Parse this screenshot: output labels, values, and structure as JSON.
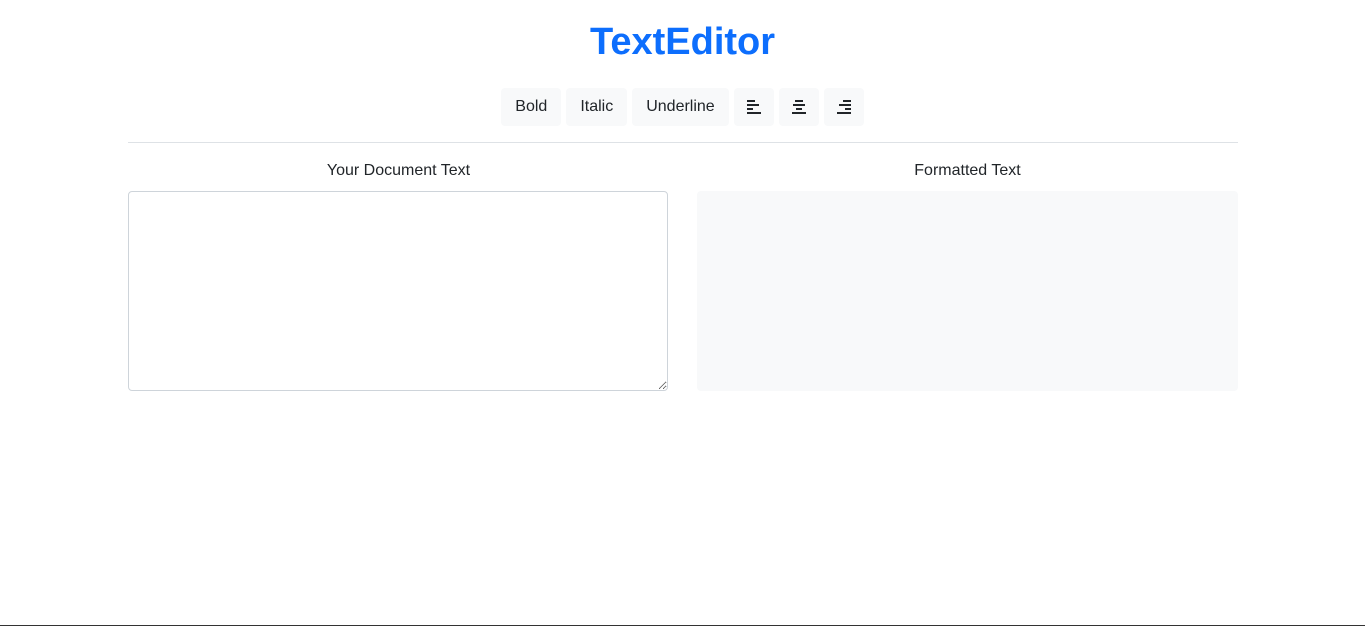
{
  "app": {
    "title": "TextEditor",
    "accent_color": "#0d6efd"
  },
  "toolbar": {
    "bold_label": "Bold",
    "italic_label": "Italic",
    "underline_label": "Underline",
    "align_left_icon": "align-left-icon",
    "align_center_icon": "align-center-icon",
    "align_right_icon": "align-right-icon"
  },
  "editor": {
    "label": "Your Document Text",
    "value": "",
    "placeholder": ""
  },
  "preview": {
    "label": "Formatted Text",
    "content": ""
  }
}
